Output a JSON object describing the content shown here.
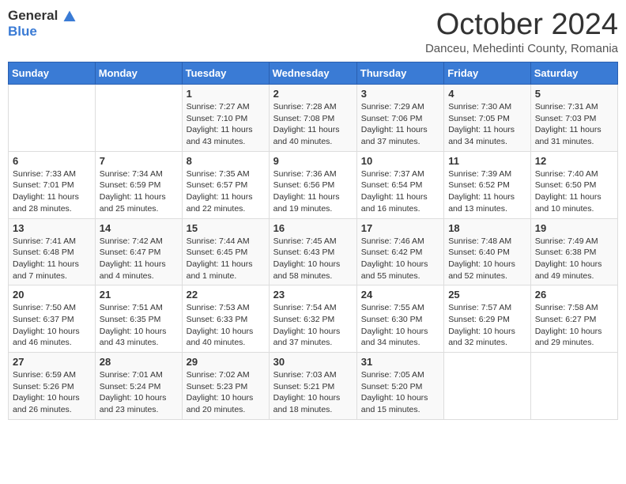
{
  "header": {
    "logo_general": "General",
    "logo_blue": "Blue",
    "month": "October 2024",
    "location": "Danceu, Mehedinti County, Romania"
  },
  "days_of_week": [
    "Sunday",
    "Monday",
    "Tuesday",
    "Wednesday",
    "Thursday",
    "Friday",
    "Saturday"
  ],
  "weeks": [
    [
      {
        "day": "",
        "sunrise": "",
        "sunset": "",
        "daylight": ""
      },
      {
        "day": "",
        "sunrise": "",
        "sunset": "",
        "daylight": ""
      },
      {
        "day": "1",
        "sunrise": "Sunrise: 7:27 AM",
        "sunset": "Sunset: 7:10 PM",
        "daylight": "Daylight: 11 hours and 43 minutes."
      },
      {
        "day": "2",
        "sunrise": "Sunrise: 7:28 AM",
        "sunset": "Sunset: 7:08 PM",
        "daylight": "Daylight: 11 hours and 40 minutes."
      },
      {
        "day": "3",
        "sunrise": "Sunrise: 7:29 AM",
        "sunset": "Sunset: 7:06 PM",
        "daylight": "Daylight: 11 hours and 37 minutes."
      },
      {
        "day": "4",
        "sunrise": "Sunrise: 7:30 AM",
        "sunset": "Sunset: 7:05 PM",
        "daylight": "Daylight: 11 hours and 34 minutes."
      },
      {
        "day": "5",
        "sunrise": "Sunrise: 7:31 AM",
        "sunset": "Sunset: 7:03 PM",
        "daylight": "Daylight: 11 hours and 31 minutes."
      }
    ],
    [
      {
        "day": "6",
        "sunrise": "Sunrise: 7:33 AM",
        "sunset": "Sunset: 7:01 PM",
        "daylight": "Daylight: 11 hours and 28 minutes."
      },
      {
        "day": "7",
        "sunrise": "Sunrise: 7:34 AM",
        "sunset": "Sunset: 6:59 PM",
        "daylight": "Daylight: 11 hours and 25 minutes."
      },
      {
        "day": "8",
        "sunrise": "Sunrise: 7:35 AM",
        "sunset": "Sunset: 6:57 PM",
        "daylight": "Daylight: 11 hours and 22 minutes."
      },
      {
        "day": "9",
        "sunrise": "Sunrise: 7:36 AM",
        "sunset": "Sunset: 6:56 PM",
        "daylight": "Daylight: 11 hours and 19 minutes."
      },
      {
        "day": "10",
        "sunrise": "Sunrise: 7:37 AM",
        "sunset": "Sunset: 6:54 PM",
        "daylight": "Daylight: 11 hours and 16 minutes."
      },
      {
        "day": "11",
        "sunrise": "Sunrise: 7:39 AM",
        "sunset": "Sunset: 6:52 PM",
        "daylight": "Daylight: 11 hours and 13 minutes."
      },
      {
        "day": "12",
        "sunrise": "Sunrise: 7:40 AM",
        "sunset": "Sunset: 6:50 PM",
        "daylight": "Daylight: 11 hours and 10 minutes."
      }
    ],
    [
      {
        "day": "13",
        "sunrise": "Sunrise: 7:41 AM",
        "sunset": "Sunset: 6:48 PM",
        "daylight": "Daylight: 11 hours and 7 minutes."
      },
      {
        "day": "14",
        "sunrise": "Sunrise: 7:42 AM",
        "sunset": "Sunset: 6:47 PM",
        "daylight": "Daylight: 11 hours and 4 minutes."
      },
      {
        "day": "15",
        "sunrise": "Sunrise: 7:44 AM",
        "sunset": "Sunset: 6:45 PM",
        "daylight": "Daylight: 11 hours and 1 minute."
      },
      {
        "day": "16",
        "sunrise": "Sunrise: 7:45 AM",
        "sunset": "Sunset: 6:43 PM",
        "daylight": "Daylight: 10 hours and 58 minutes."
      },
      {
        "day": "17",
        "sunrise": "Sunrise: 7:46 AM",
        "sunset": "Sunset: 6:42 PM",
        "daylight": "Daylight: 10 hours and 55 minutes."
      },
      {
        "day": "18",
        "sunrise": "Sunrise: 7:48 AM",
        "sunset": "Sunset: 6:40 PM",
        "daylight": "Daylight: 10 hours and 52 minutes."
      },
      {
        "day": "19",
        "sunrise": "Sunrise: 7:49 AM",
        "sunset": "Sunset: 6:38 PM",
        "daylight": "Daylight: 10 hours and 49 minutes."
      }
    ],
    [
      {
        "day": "20",
        "sunrise": "Sunrise: 7:50 AM",
        "sunset": "Sunset: 6:37 PM",
        "daylight": "Daylight: 10 hours and 46 minutes."
      },
      {
        "day": "21",
        "sunrise": "Sunrise: 7:51 AM",
        "sunset": "Sunset: 6:35 PM",
        "daylight": "Daylight: 10 hours and 43 minutes."
      },
      {
        "day": "22",
        "sunrise": "Sunrise: 7:53 AM",
        "sunset": "Sunset: 6:33 PM",
        "daylight": "Daylight: 10 hours and 40 minutes."
      },
      {
        "day": "23",
        "sunrise": "Sunrise: 7:54 AM",
        "sunset": "Sunset: 6:32 PM",
        "daylight": "Daylight: 10 hours and 37 minutes."
      },
      {
        "day": "24",
        "sunrise": "Sunrise: 7:55 AM",
        "sunset": "Sunset: 6:30 PM",
        "daylight": "Daylight: 10 hours and 34 minutes."
      },
      {
        "day": "25",
        "sunrise": "Sunrise: 7:57 AM",
        "sunset": "Sunset: 6:29 PM",
        "daylight": "Daylight: 10 hours and 32 minutes."
      },
      {
        "day": "26",
        "sunrise": "Sunrise: 7:58 AM",
        "sunset": "Sunset: 6:27 PM",
        "daylight": "Daylight: 10 hours and 29 minutes."
      }
    ],
    [
      {
        "day": "27",
        "sunrise": "Sunrise: 6:59 AM",
        "sunset": "Sunset: 5:26 PM",
        "daylight": "Daylight: 10 hours and 26 minutes."
      },
      {
        "day": "28",
        "sunrise": "Sunrise: 7:01 AM",
        "sunset": "Sunset: 5:24 PM",
        "daylight": "Daylight: 10 hours and 23 minutes."
      },
      {
        "day": "29",
        "sunrise": "Sunrise: 7:02 AM",
        "sunset": "Sunset: 5:23 PM",
        "daylight": "Daylight: 10 hours and 20 minutes."
      },
      {
        "day": "30",
        "sunrise": "Sunrise: 7:03 AM",
        "sunset": "Sunset: 5:21 PM",
        "daylight": "Daylight: 10 hours and 18 minutes."
      },
      {
        "day": "31",
        "sunrise": "Sunrise: 7:05 AM",
        "sunset": "Sunset: 5:20 PM",
        "daylight": "Daylight: 10 hours and 15 minutes."
      },
      {
        "day": "",
        "sunrise": "",
        "sunset": "",
        "daylight": ""
      },
      {
        "day": "",
        "sunrise": "",
        "sunset": "",
        "daylight": ""
      }
    ]
  ]
}
